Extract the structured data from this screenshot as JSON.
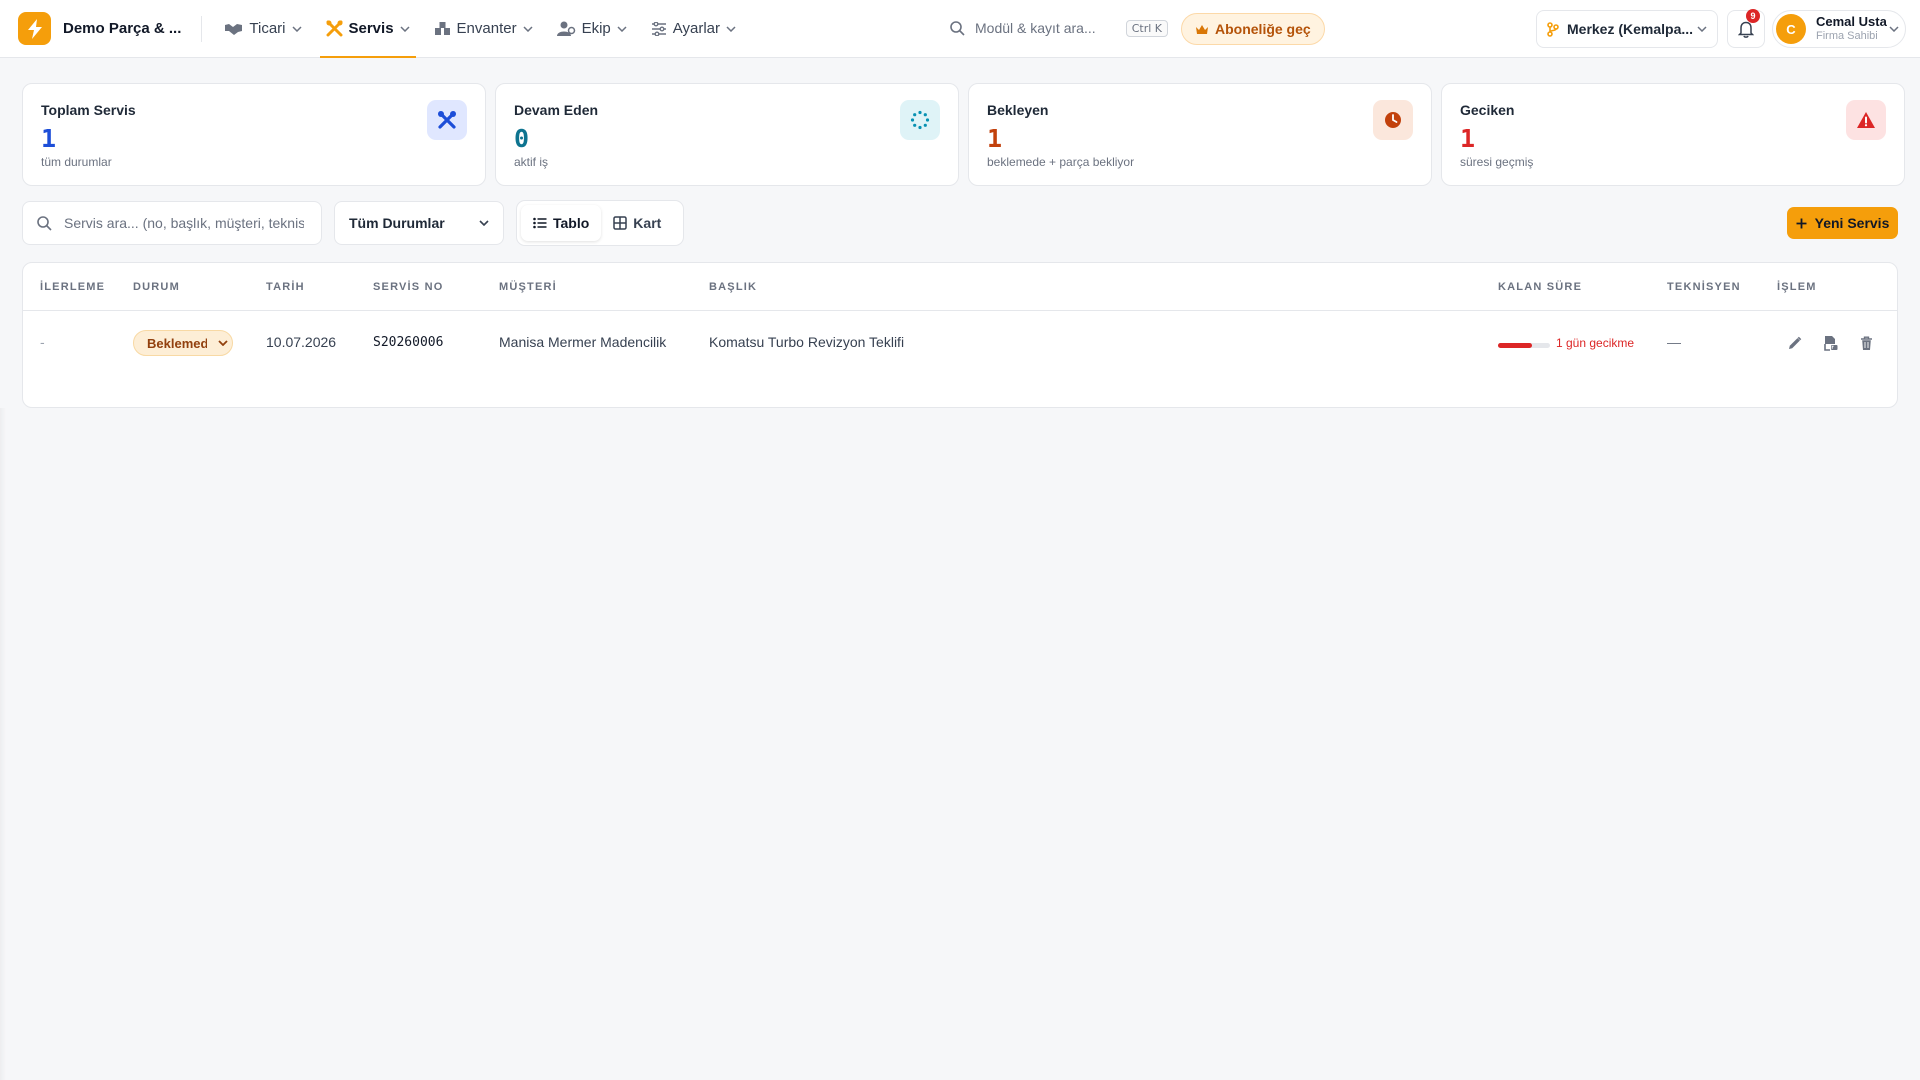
{
  "header": {
    "brand_name": "Demo Parça & ...",
    "nav": [
      {
        "label": "Ticari",
        "icon": "handshake-icon"
      },
      {
        "label": "Servis",
        "icon": "tools-icon",
        "active": true
      },
      {
        "label": "Envanter",
        "icon": "warehouse-icon"
      },
      {
        "label": "Ekip",
        "icon": "team-icon"
      },
      {
        "label": "Ayarlar",
        "icon": "sliders-icon"
      }
    ],
    "search_placeholder": "Modül & kayıt ara...",
    "search_shortcut": "Ctrl K",
    "upgrade_label": "Aboneliğe geç",
    "branch_label": "Merkez (Kemalpa...",
    "notification_count": "9",
    "user": {
      "initial": "C",
      "name": "Cemal Usta",
      "role": "Firma Sahibi"
    }
  },
  "stats": [
    {
      "title": "Toplam Servis",
      "value": "1",
      "subtitle": "tüm durumlar",
      "color": "#1d4ed8",
      "icon": "tools-icon"
    },
    {
      "title": "Devam Eden",
      "value": "0",
      "subtitle": "aktif iş",
      "color": "#0e7490",
      "icon": "spinner-icon"
    },
    {
      "title": "Bekleyen",
      "value": "1",
      "subtitle": "beklemede + parça bekliyor",
      "color": "#c2410c",
      "icon": "clock-icon"
    },
    {
      "title": "Geciken",
      "value": "1",
      "subtitle": "süresi geçmiş",
      "color": "#dc2626",
      "icon": "warning-icon"
    }
  ],
  "toolbar": {
    "search_placeholder": "Servis ara... (no, başlık, müşteri, teknisyen)",
    "status_filter": "Tüm Durumlar",
    "view_table": "Tablo",
    "view_card": "Kart",
    "new_button": "Yeni Servis"
  },
  "table": {
    "columns": [
      "İLERLEME",
      "DURUM",
      "TARİH",
      "SERVİS NO",
      "MÜŞTERİ",
      "BAŞLIK",
      "KALAN SÜRE",
      "TEKNİSYEN",
      "İŞLEM"
    ],
    "rows": [
      {
        "progress": "-",
        "status": "Beklemede",
        "date": "10.07.2026",
        "service_no": "S20260006",
        "customer": "Manisa Mermer Madencilik",
        "title": "Komatsu Turbo Revizyon Teklifi",
        "remaining_fraction": 0.65,
        "remaining_text": "1 gün gecikme",
        "technician": "—"
      }
    ]
  },
  "colors": {
    "accent": "#f59e0b",
    "danger": "#dc2626"
  }
}
